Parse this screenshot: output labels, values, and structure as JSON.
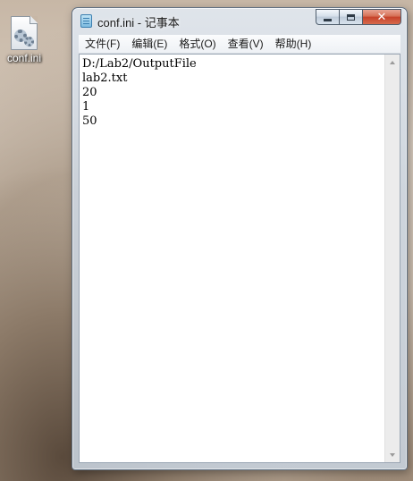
{
  "desktop": {
    "icon_label": "conf.ini"
  },
  "window": {
    "title": "conf.ini - 记事本",
    "close_glyph": "✕"
  },
  "menu": {
    "items": [
      {
        "label": "文件(F)"
      },
      {
        "label": "编辑(E)"
      },
      {
        "label": "格式(O)"
      },
      {
        "label": "查看(V)"
      },
      {
        "label": "帮助(H)"
      }
    ]
  },
  "editor": {
    "lines": [
      "D:/Lab2/OutputFile",
      "lab2.txt",
      "20",
      "1",
      "50"
    ]
  },
  "icons": {
    "file": "config-file-icon",
    "app": "notepad-icon"
  },
  "colors": {
    "close_button": "#c6412a",
    "editor_bg": "#ffffff"
  }
}
